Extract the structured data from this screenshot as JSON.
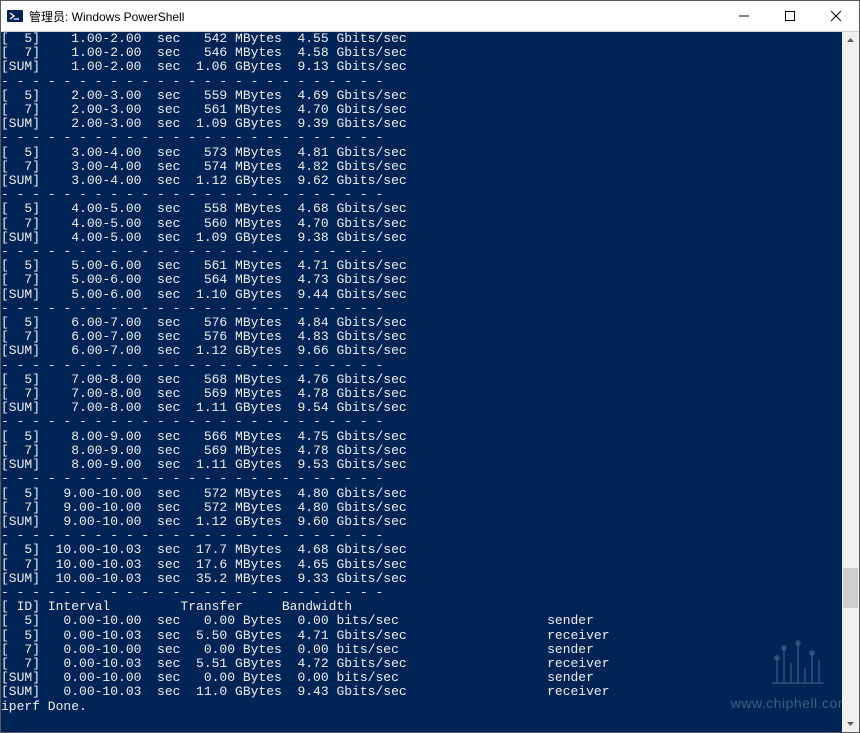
{
  "window": {
    "title": "管理员: Windows PowerShell"
  },
  "groups": [
    {
      "rows": [
        {
          "id": "[  5]",
          "interval": "1.00-2.00",
          "unit": "sec",
          "transfer": "542 MBytes",
          "bandwidth": "4.55 Gbits/sec"
        },
        {
          "id": "[  7]",
          "interval": "1.00-2.00",
          "unit": "sec",
          "transfer": "546 MBytes",
          "bandwidth": "4.58 Gbits/sec"
        },
        {
          "id": "[SUM]",
          "interval": "1.00-2.00",
          "unit": "sec",
          "transfer": "1.06 GBytes",
          "bandwidth": "9.13 Gbits/sec"
        }
      ]
    },
    {
      "rows": [
        {
          "id": "[  5]",
          "interval": "2.00-3.00",
          "unit": "sec",
          "transfer": "559 MBytes",
          "bandwidth": "4.69 Gbits/sec"
        },
        {
          "id": "[  7]",
          "interval": "2.00-3.00",
          "unit": "sec",
          "transfer": "561 MBytes",
          "bandwidth": "4.70 Gbits/sec"
        },
        {
          "id": "[SUM]",
          "interval": "2.00-3.00",
          "unit": "sec",
          "transfer": "1.09 GBytes",
          "bandwidth": "9.39 Gbits/sec"
        }
      ]
    },
    {
      "rows": [
        {
          "id": "[  5]",
          "interval": "3.00-4.00",
          "unit": "sec",
          "transfer": "573 MBytes",
          "bandwidth": "4.81 Gbits/sec"
        },
        {
          "id": "[  7]",
          "interval": "3.00-4.00",
          "unit": "sec",
          "transfer": "574 MBytes",
          "bandwidth": "4.82 Gbits/sec"
        },
        {
          "id": "[SUM]",
          "interval": "3.00-4.00",
          "unit": "sec",
          "transfer": "1.12 GBytes",
          "bandwidth": "9.62 Gbits/sec"
        }
      ]
    },
    {
      "rows": [
        {
          "id": "[  5]",
          "interval": "4.00-5.00",
          "unit": "sec",
          "transfer": "558 MBytes",
          "bandwidth": "4.68 Gbits/sec"
        },
        {
          "id": "[  7]",
          "interval": "4.00-5.00",
          "unit": "sec",
          "transfer": "560 MBytes",
          "bandwidth": "4.70 Gbits/sec"
        },
        {
          "id": "[SUM]",
          "interval": "4.00-5.00",
          "unit": "sec",
          "transfer": "1.09 GBytes",
          "bandwidth": "9.38 Gbits/sec"
        }
      ]
    },
    {
      "rows": [
        {
          "id": "[  5]",
          "interval": "5.00-6.00",
          "unit": "sec",
          "transfer": "561 MBytes",
          "bandwidth": "4.71 Gbits/sec"
        },
        {
          "id": "[  7]",
          "interval": "5.00-6.00",
          "unit": "sec",
          "transfer": "564 MBytes",
          "bandwidth": "4.73 Gbits/sec"
        },
        {
          "id": "[SUM]",
          "interval": "5.00-6.00",
          "unit": "sec",
          "transfer": "1.10 GBytes",
          "bandwidth": "9.44 Gbits/sec"
        }
      ]
    },
    {
      "rows": [
        {
          "id": "[  5]",
          "interval": "6.00-7.00",
          "unit": "sec",
          "transfer": "576 MBytes",
          "bandwidth": "4.84 Gbits/sec"
        },
        {
          "id": "[  7]",
          "interval": "6.00-7.00",
          "unit": "sec",
          "transfer": "576 MBytes",
          "bandwidth": "4.83 Gbits/sec"
        },
        {
          "id": "[SUM]",
          "interval": "6.00-7.00",
          "unit": "sec",
          "transfer": "1.12 GBytes",
          "bandwidth": "9.66 Gbits/sec"
        }
      ]
    },
    {
      "rows": [
        {
          "id": "[  5]",
          "interval": "7.00-8.00",
          "unit": "sec",
          "transfer": "568 MBytes",
          "bandwidth": "4.76 Gbits/sec"
        },
        {
          "id": "[  7]",
          "interval": "7.00-8.00",
          "unit": "sec",
          "transfer": "569 MBytes",
          "bandwidth": "4.78 Gbits/sec"
        },
        {
          "id": "[SUM]",
          "interval": "7.00-8.00",
          "unit": "sec",
          "transfer": "1.11 GBytes",
          "bandwidth": "9.54 Gbits/sec"
        }
      ]
    },
    {
      "rows": [
        {
          "id": "[  5]",
          "interval": "8.00-9.00",
          "unit": "sec",
          "transfer": "566 MBytes",
          "bandwidth": "4.75 Gbits/sec"
        },
        {
          "id": "[  7]",
          "interval": "8.00-9.00",
          "unit": "sec",
          "transfer": "569 MBytes",
          "bandwidth": "4.78 Gbits/sec"
        },
        {
          "id": "[SUM]",
          "interval": "8.00-9.00",
          "unit": "sec",
          "transfer": "1.11 GBytes",
          "bandwidth": "9.53 Gbits/sec"
        }
      ]
    },
    {
      "rows": [
        {
          "id": "[  5]",
          "interval": "9.00-10.00",
          "unit": "sec",
          "transfer": "572 MBytes",
          "bandwidth": "4.80 Gbits/sec"
        },
        {
          "id": "[  7]",
          "interval": "9.00-10.00",
          "unit": "sec",
          "transfer": "572 MBytes",
          "bandwidth": "4.80 Gbits/sec"
        },
        {
          "id": "[SUM]",
          "interval": "9.00-10.00",
          "unit": "sec",
          "transfer": "1.12 GBytes",
          "bandwidth": "9.60 Gbits/sec"
        }
      ]
    },
    {
      "rows": [
        {
          "id": "[  5]",
          "interval": "10.00-10.03",
          "unit": "sec",
          "transfer": "17.7 MBytes",
          "bandwidth": "4.68 Gbits/sec"
        },
        {
          "id": "[  7]",
          "interval": "10.00-10.03",
          "unit": "sec",
          "transfer": "17.6 MBytes",
          "bandwidth": "4.65 Gbits/sec"
        },
        {
          "id": "[SUM]",
          "interval": "10.00-10.03",
          "unit": "sec",
          "transfer": "35.2 MBytes",
          "bandwidth": "9.33 Gbits/sec"
        }
      ]
    }
  ],
  "summaryHeader": {
    "id": "[ ID]",
    "interval": "Interval",
    "transfer": "Transfer",
    "bandwidth": "Bandwidth"
  },
  "summary": [
    {
      "id": "[  5]",
      "interval": "0.00-10.00",
      "unit": "sec",
      "transfer": "0.00 Bytes",
      "bandwidth": "0.00 bits/sec",
      "role": "sender"
    },
    {
      "id": "[  5]",
      "interval": "0.00-10.03",
      "unit": "sec",
      "transfer": "5.50 GBytes",
      "bandwidth": "4.71 Gbits/sec",
      "role": "receiver"
    },
    {
      "id": "[  7]",
      "interval": "0.00-10.00",
      "unit": "sec",
      "transfer": "0.00 Bytes",
      "bandwidth": "0.00 bits/sec",
      "role": "sender"
    },
    {
      "id": "[  7]",
      "interval": "0.00-10.03",
      "unit": "sec",
      "transfer": "5.51 GBytes",
      "bandwidth": "4.72 Gbits/sec",
      "role": "receiver"
    },
    {
      "id": "[SUM]",
      "interval": "0.00-10.00",
      "unit": "sec",
      "transfer": "0.00 Bytes",
      "bandwidth": "0.00 bits/sec",
      "role": "sender"
    },
    {
      "id": "[SUM]",
      "interval": "0.00-10.03",
      "unit": "sec",
      "transfer": "11.0 GBytes",
      "bandwidth": "9.43 Gbits/sec",
      "role": "receiver"
    }
  ],
  "footer": "iperf Done.",
  "watermark": "www.chiphell.com",
  "separator": "- - - - - - - - - - - - - - - - - - - - - - - - -"
}
